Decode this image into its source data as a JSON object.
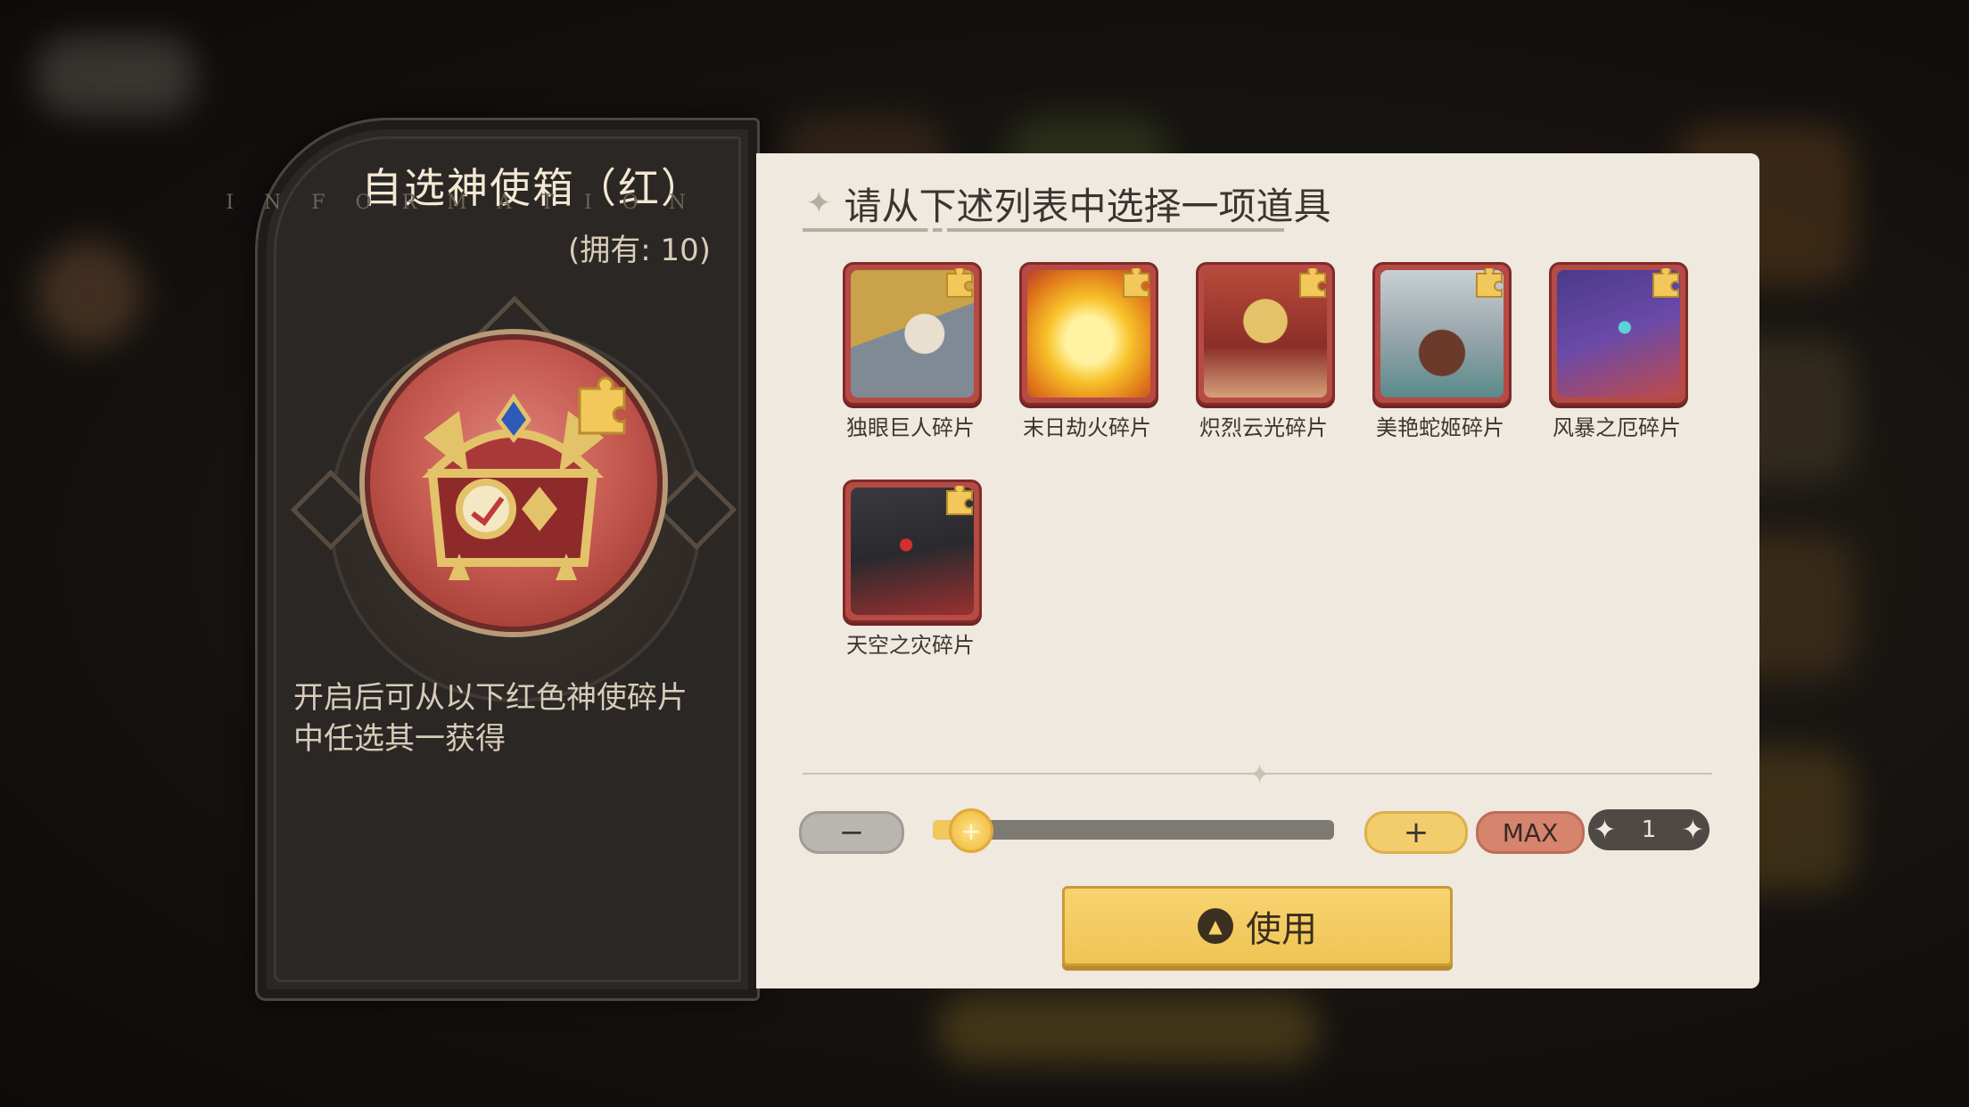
{
  "box": {
    "title": "自选神使箱（红）",
    "watermark": "INFORMATION",
    "owned": "(拥有: 10)",
    "description": "开启后可从以下红色神使碎片中任选其一获得"
  },
  "selection": {
    "header": "请从下述列表中选择一项道具",
    "items": [
      {
        "label": "独眼巨人碎片",
        "icon": "cyclops-helmet-icon"
      },
      {
        "label": "末日劫火碎片",
        "icon": "doom-fire-icon"
      },
      {
        "label": "炽烈云光碎片",
        "icon": "blazing-cloud-icon"
      },
      {
        "label": "美艳蛇姬碎片",
        "icon": "snake-princess-icon"
      },
      {
        "label": "风暴之厄碎片",
        "icon": "storm-dragon-icon"
      },
      {
        "label": "天空之灾碎片",
        "icon": "sky-calamity-icon"
      }
    ]
  },
  "controls": {
    "minus_label": "−",
    "plus_label": "+",
    "max_label": "MAX",
    "quantity": "1",
    "slider_fraction": 0.0,
    "use_label": "使用"
  },
  "colors": {
    "accent_gold": "#f3cd6b",
    "rarity_red": "#b64a45",
    "panel_light": "#efe9df",
    "panel_dark": "#2a2725"
  }
}
